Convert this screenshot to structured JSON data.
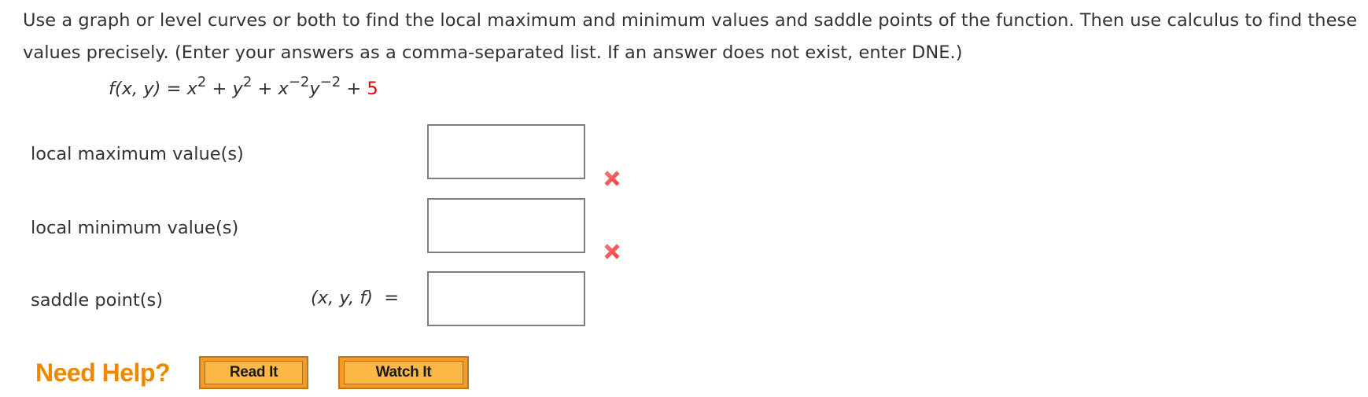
{
  "question": {
    "instructions": "Use a graph or level curves or both to find the local maximum and minimum values and saddle points of the function. Then use calculus to find these values precisely. (Enter your answers as a comma-separated list. If an answer does not exist, enter DNE.)",
    "formula": {
      "lhs": "f(x, y)",
      "equals": "=",
      "term1_base": "x",
      "term1_exp": "2",
      "plus1": "+",
      "term2_base": "y",
      "term2_exp": "2",
      "plus2": "+",
      "term3_base_x": "x",
      "term3_exp_x": "−2",
      "term3_base_y": "y",
      "term3_exp_y": "−2",
      "plus3": "+",
      "constant": "5",
      "constant_color": "#e00000"
    }
  },
  "answers": [
    {
      "label": "local maximum value(s)",
      "value": "",
      "status": "incorrect",
      "status_icon": "x-mark-icon"
    },
    {
      "label": "local minimum value(s)",
      "value": "",
      "status": "incorrect",
      "status_icon": "x-mark-icon"
    },
    {
      "label": "saddle point(s)",
      "prefix": "(x, y, f)",
      "prefix_equals": "=",
      "value": "",
      "status": "none"
    }
  ],
  "help": {
    "title": "Need Help?",
    "title_color": "#ee8800",
    "buttons": [
      {
        "label": "Read It"
      },
      {
        "label": "Watch It"
      }
    ]
  },
  "colors": {
    "text": "#333333",
    "error": "#f04a4a",
    "button_fill": "#fbb845",
    "button_border": "#f79a1e"
  }
}
